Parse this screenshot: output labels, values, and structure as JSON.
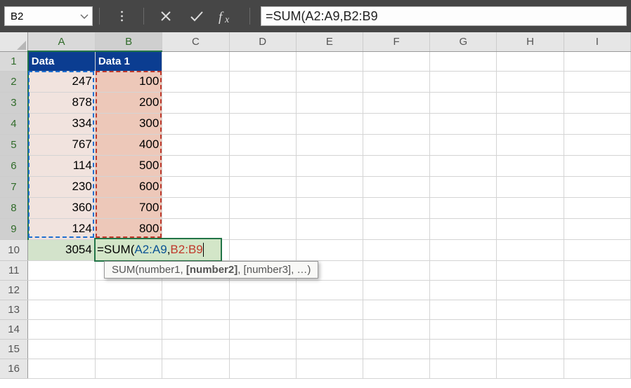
{
  "nameBox": "B2",
  "formula": "=SUM(A2:A9,B2:B9",
  "colHeads": [
    "A",
    "B",
    "C",
    "D",
    "E",
    "F",
    "G",
    "H",
    "I"
  ],
  "colWidthDefault": 96,
  "rowHeads": [
    "1",
    "2",
    "3",
    "4",
    "5",
    "6",
    "7",
    "8",
    "9",
    "10",
    "11",
    "12",
    "13",
    "14",
    "15",
    "16"
  ],
  "headers": {
    "A": "Data",
    "B": "Data 1"
  },
  "columnA": [
    "247",
    "878",
    "334",
    "767",
    "114",
    "230",
    "360",
    "124"
  ],
  "columnB": [
    "100",
    "200",
    "300",
    "400",
    "500",
    "600",
    "700",
    "800"
  ],
  "A10": "3054",
  "edit": {
    "pieces": [
      {
        "text": "=SUM(",
        "cls": "c-black"
      },
      {
        "text": "A2:A9",
        "cls": "c-blue"
      },
      {
        "text": ",",
        "cls": "c-black"
      },
      {
        "text": "B2:B9",
        "cls": "c-red"
      }
    ]
  },
  "tooltip": {
    "fn": "SUM",
    "args": [
      "number1",
      "[number2]",
      "[number3]",
      "…"
    ],
    "activeIndex": 1
  },
  "chart_data": {
    "type": "table",
    "note": "Spreadsheet cell grid with a SUM formula being authored in B10",
    "columns": [
      "Data",
      "Data 1"
    ],
    "series": [
      {
        "name": "Data",
        "values": [
          247,
          878,
          334,
          767,
          114,
          230,
          360,
          124
        ]
      },
      {
        "name": "Data 1",
        "values": [
          100,
          200,
          300,
          400,
          500,
          600,
          700,
          800
        ]
      }
    ],
    "computed": {
      "sum_Data": 3054
    },
    "formula_in_progress": "=SUM(A2:A9,B2:B9"
  }
}
